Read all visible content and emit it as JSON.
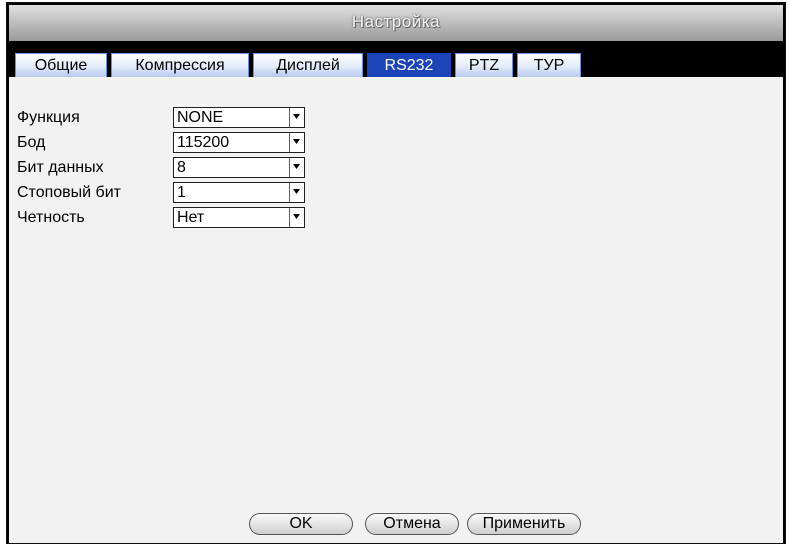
{
  "window": {
    "title": "Настройка"
  },
  "tabs": [
    {
      "label": "Общие",
      "active": false
    },
    {
      "label": "Компрессия",
      "active": false
    },
    {
      "label": "Дисплей",
      "active": false
    },
    {
      "label": "RS232",
      "active": true
    },
    {
      "label": "PTZ",
      "active": false
    },
    {
      "label": "ТУР",
      "active": false
    }
  ],
  "form": {
    "fields": [
      {
        "label": "Функция",
        "value": "NONE"
      },
      {
        "label": "Бод",
        "value": "115200"
      },
      {
        "label": "Бит данных",
        "value": "8"
      },
      {
        "label": "Стоповый бит",
        "value": "1"
      },
      {
        "label": "Четность",
        "value": "Нет"
      }
    ]
  },
  "buttons": {
    "ok": "OK",
    "cancel": "Отмена",
    "apply": "Применить"
  },
  "colors": {
    "active_tab": "#1c44b8",
    "content_bg": "#f2f2f2",
    "frame": "#000000"
  },
  "icons": {
    "dropdown": "chevron-down-icon"
  }
}
